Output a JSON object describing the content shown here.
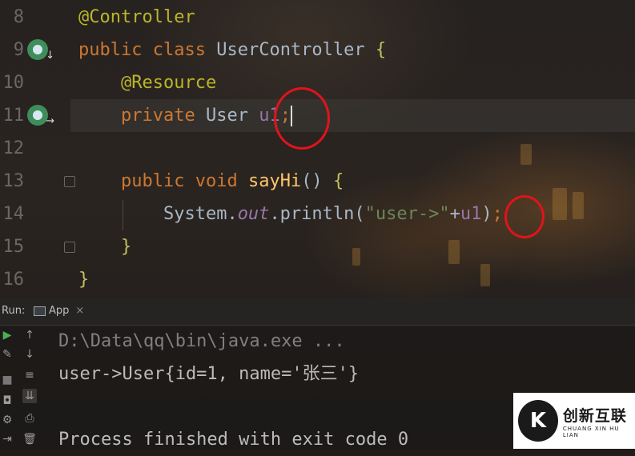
{
  "editor": {
    "line_numbers": [
      "8",
      "9",
      "10",
      "11",
      "12",
      "13",
      "14",
      "15",
      "16"
    ],
    "lines": {
      "l8_annotation": "@Controller",
      "l9_public": "public",
      "l9_class": "class",
      "l9_name": "UserController",
      "l9_brace": "{",
      "l10_annotation": "@Resource",
      "l11_private": "private",
      "l11_type": "User",
      "l11_field": "u1",
      "l11_semi": ";",
      "l13_public": "public",
      "l13_void": "void",
      "l13_method": "sayHi",
      "l13_parens": "()",
      "l13_brace": "{",
      "l14_system": "System.",
      "l14_out": "out",
      "l14_println": ".println(",
      "l14_string": "\"user->\"",
      "l14_plus": "+",
      "l14_field": "u1",
      "l14_close": ")",
      "l14_semi": ";",
      "l15_brace": "}",
      "l16_brace": "}"
    }
  },
  "run_panel": {
    "label": "Run:",
    "tab_label": "App",
    "tab_close": "×",
    "output": [
      "D:\\Data\\qq\\bin\\java.exe ...",
      "user->User{id=1, name='张三'}",
      "",
      "Process finished with exit code 0"
    ]
  },
  "watermark": {
    "logo_text": "创新互联",
    "logo_sub": "CHUANG XIN HU LIAN"
  },
  "colors": {
    "keyword": "#cc7832",
    "annotation": "#bbb529",
    "field": "#9876aa",
    "method": "#ffc66d",
    "string": "#6a8759",
    "highlight_circle": "#e0141b"
  }
}
